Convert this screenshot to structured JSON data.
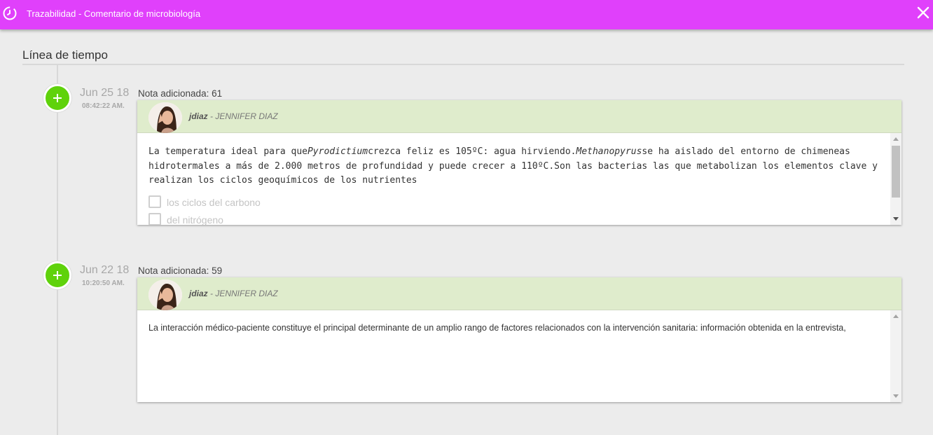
{
  "window": {
    "title": "Trazabilidad - Comentario de microbiología",
    "icon": "clock-history-icon",
    "close_icon": "close-icon",
    "accent_color": "#e040fb"
  },
  "timeline": {
    "heading": "Línea de tiempo",
    "entries": [
      {
        "date": "Jun 25 18",
        "time": "08:42:22 AM.",
        "note_title": "Nota adicionada: 61",
        "user_login": "jdiaz",
        "user_name": " - JENNIFER DIAZ",
        "body_parts": [
          "La temperatura ideal para que",
          "Pyrodictium",
          "crezca feliz es 105ºC: agua hirviendo.",
          "Methanopyrus",
          "se ha aislado del entorno de chimeneas hidrotermales a más de 2.000 metros de profundidad y puede crecer a 110ºC.Son las bacterias las que metabolizan los elementos clave y realizan los ciclos geoquímicos de los nutrientes"
        ],
        "checklist": [
          {
            "label": "los ciclos del carbono",
            "checked": false
          },
          {
            "label": "del nitrógeno",
            "checked": false
          }
        ]
      },
      {
        "date": "Jun 22 18",
        "time": "10:20:50 AM.",
        "note_title": "Nota adicionada: 59",
        "user_login": "jdiaz",
        "user_name": " - JENNIFER DIAZ",
        "body": "La interacción médico-paciente constituye el principal determinante de un amplio rango de factores relacionados con la intervención sanitaria: información obtenida en la entrevista,"
      }
    ]
  }
}
